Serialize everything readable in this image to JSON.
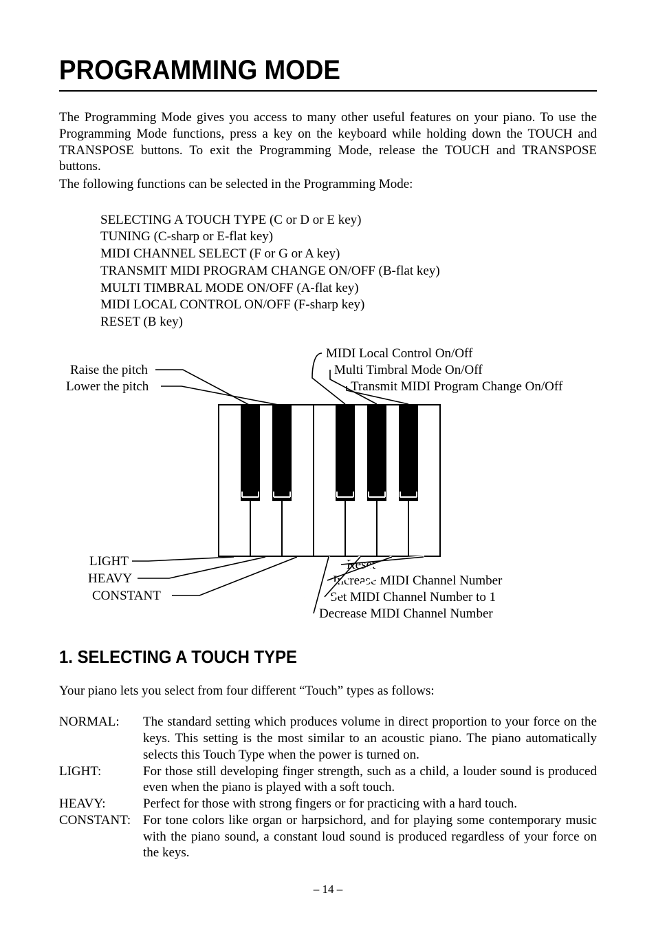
{
  "title": "PROGRAMMING MODE",
  "intro_para": "The Programming Mode gives you access to many other useful features on your piano.  To use the Programming Mode functions, press a key on the keyboard while holding down the TOUCH and TRANSPOSE buttons.  To exit the Programming Mode, release the TOUCH and TRANSPOSE buttons.",
  "intro_followup": "The following functions can be selected in the Programming Mode:",
  "functions": [
    "SELECTING A TOUCH TYPE (C or D or E key)",
    "TUNING (C-sharp or E-flat key)",
    "MIDI CHANNEL SELECT (F or G or A key)",
    "TRANSMIT MIDI PROGRAM CHANGE ON/OFF (B-flat key)",
    "MULTI TIMBRAL MODE ON/OFF (A-flat key)",
    "MIDI LOCAL CONTROL ON/OFF (F-sharp key)",
    "RESET (B key)"
  ],
  "diagram_labels": {
    "midi_local": "MIDI Local Control On/Off",
    "multi_timbral": "Multi Timbral Mode On/Off",
    "transmit": "Transmit MIDI Program Change On/Off",
    "raise_pitch": "Raise the pitch",
    "lower_pitch": "Lower the pitch",
    "light": "LIGHT",
    "heavy": "HEAVY",
    "constant": "CONSTANT",
    "reset": "Reset",
    "increase_midi": "Increase MIDI Channel Number",
    "set_midi_1": "Set MIDI Channel Number to 1",
    "decrease_midi": "Decrease MIDI Channel Number"
  },
  "section1_heading": "1. SELECTING A TOUCH TYPE",
  "section1_intro": "Your piano lets you select from four different “Touch” types as follows:",
  "defs": [
    {
      "term": "NORMAL:",
      "desc": "The standard setting which produces volume in direct proportion to your force on the keys.  This setting is the most similar to an acoustic piano.  The piano automatically selects this Touch Type when the power is turned on."
    },
    {
      "term": "LIGHT:",
      "desc": "For those still developing finger strength, such as a child, a louder sound is produced even when the piano is played with a soft touch."
    },
    {
      "term": "HEAVY:",
      "desc": "Perfect for those with strong fingers or for practicing with a hard touch."
    },
    {
      "term": "CONSTANT:",
      "desc": "For tone colors like organ or harpsichord, and for playing some contemporary music with the piano sound, a constant loud sound is produced regardless of your force on the keys."
    }
  ],
  "page_number": "–  14  –"
}
